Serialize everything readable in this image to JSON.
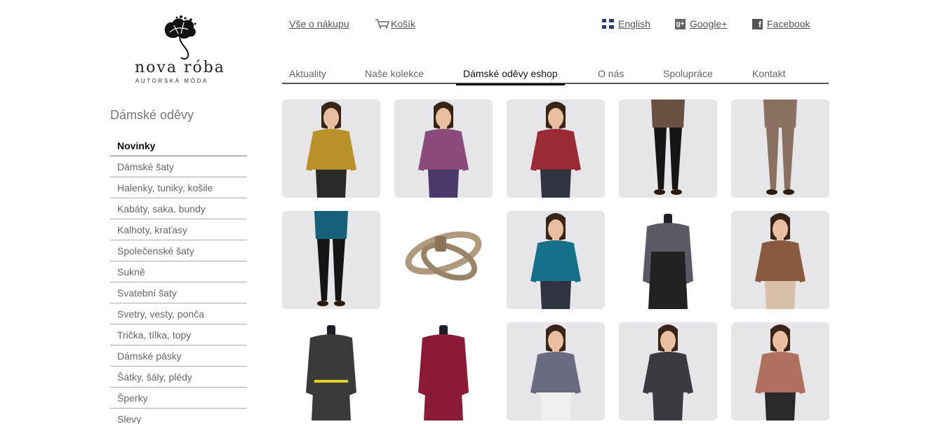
{
  "logo": {
    "brand": "nova róba",
    "tagline": "AUTORSKÁ MÓDA"
  },
  "top_links": {
    "info": "Vše o nákupu",
    "cart": "Košík",
    "english": "English",
    "google": "Google+",
    "facebook": "Facebook"
  },
  "nav": [
    "Aktuality",
    "Naše kolekce",
    "Dámské oděvy eshop",
    "O nás",
    "Spolupráce",
    "Kontakt"
  ],
  "nav_active": "Dámské oděvy eshop",
  "sidebar": {
    "title": "Dámské oděvy",
    "items": [
      "Novinky",
      "Dámské šaty",
      "Halenky, tuniky, košile",
      "Kabáty, saka, bundy",
      "Kalhoty, kraťasy",
      "Společenské šaty",
      "Sukně",
      "Svatební šaty",
      "Svetry, vesty, ponča",
      "Trička, tílka, topy",
      "Dámské pásky",
      "Šátky, šály, plédy",
      "Šperky",
      "Slevy"
    ],
    "active": "Novinky"
  },
  "products": [
    {
      "kind": "model",
      "bg": "#e6e6e8",
      "top": "#b8912a",
      "bottom": "#2a2a2a",
      "skin": "#e8c0a0"
    },
    {
      "kind": "model",
      "bg": "#e6e6e8",
      "top": "#8a4a7a",
      "bottom": "#4a3a6a",
      "skin": "#e8c0a0"
    },
    {
      "kind": "model",
      "bg": "#e6e6e8",
      "top": "#9a2a35",
      "bottom": "#2f3440",
      "skin": "#e8c0a0"
    },
    {
      "kind": "legs",
      "bg": "#e6e6e8",
      "top": "#6a5040",
      "bottom": "#151515",
      "skin": "#e8c0a0"
    },
    {
      "kind": "legs",
      "bg": "#e6e6e8",
      "top": "#8a7060",
      "bottom": "#8a7060",
      "skin": "#e8c0a0"
    },
    {
      "kind": "legs",
      "bg": "#e6e6e8",
      "top": "#16607a",
      "bottom": "#151515",
      "skin": "#e8c0a0"
    },
    {
      "kind": "belt",
      "bg": "#ffffff",
      "top": "#b09a7e",
      "bottom": "#b09a7e",
      "skin": "#e8c0a0"
    },
    {
      "kind": "model",
      "bg": "#e6e6e8",
      "top": "#16708a",
      "bottom": "#2f3440",
      "skin": "#e8c0a0"
    },
    {
      "kind": "mannequin",
      "bg": "#ffffff",
      "top": "#5a5a66",
      "bottom": "#222222",
      "skin": "#1e1e26"
    },
    {
      "kind": "model",
      "bg": "#e6e6e8",
      "top": "#8a5a40",
      "bottom": "#d8c0a8",
      "skin": "#e8c0a0"
    },
    {
      "kind": "mannequin",
      "bg": "#ffffff",
      "top": "#3a3a3a",
      "bottom": "#3a3a3a",
      "skin": "#1e1e26"
    },
    {
      "kind": "mannequin",
      "bg": "#ffffff",
      "top": "#8a1a35",
      "bottom": "#8a1a35",
      "skin": "#1e1e26"
    },
    {
      "kind": "model",
      "bg": "#e6e6e8",
      "top": "#6a6a80",
      "bottom": "#f0f0f0",
      "skin": "#e8c0a0"
    },
    {
      "kind": "model",
      "bg": "#e6e6e8",
      "top": "#3a3a40",
      "bottom": "#3a3a40",
      "skin": "#e8c0a0"
    },
    {
      "kind": "model",
      "bg": "#e6e6e8",
      "top": "#b07060",
      "bottom": "#2a2a2a",
      "skin": "#e8c0a0"
    }
  ]
}
